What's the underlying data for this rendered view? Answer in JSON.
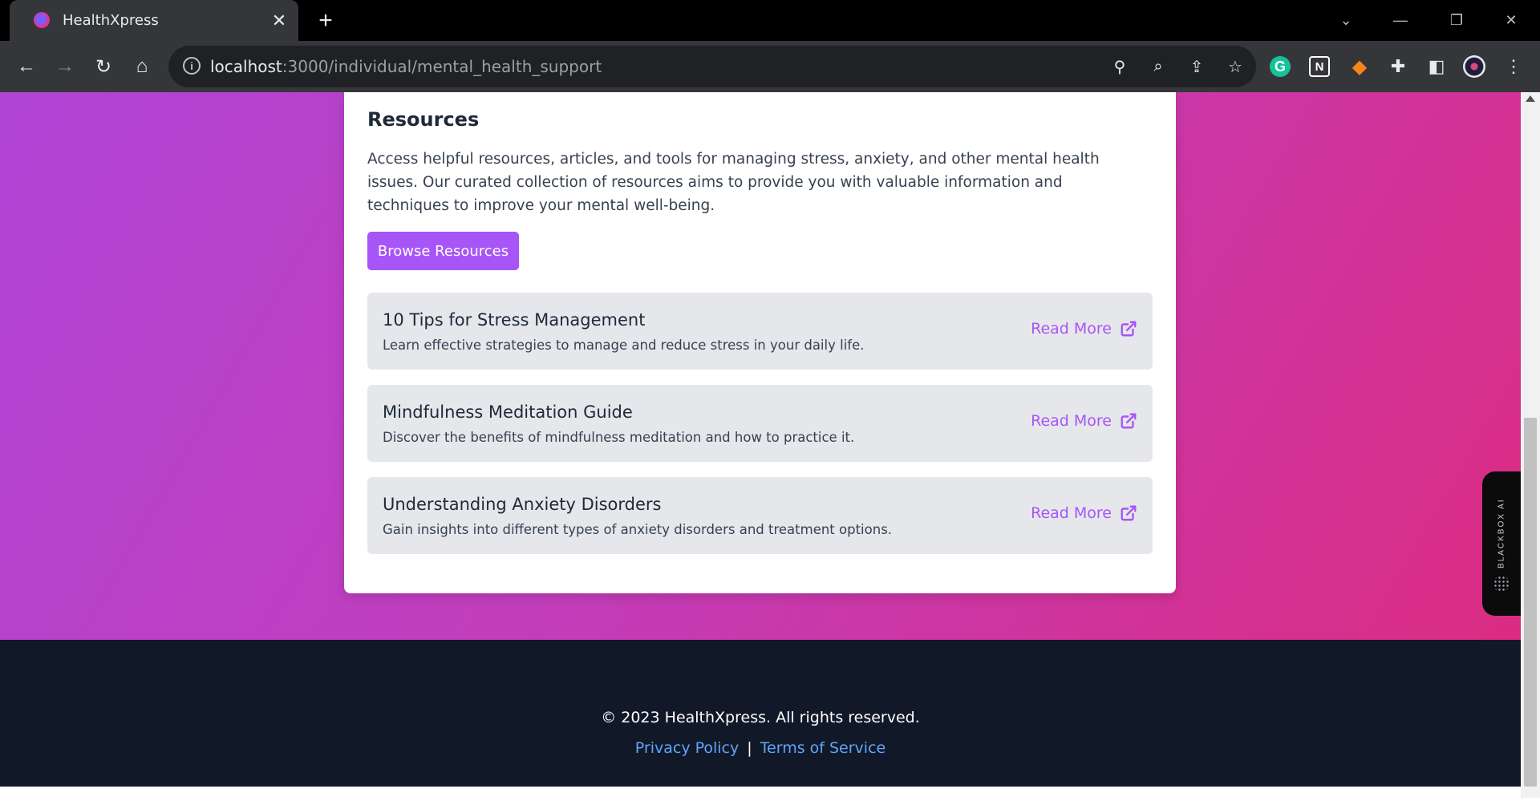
{
  "browser": {
    "tab_title": "HealthXpress",
    "url_host": "localhost",
    "url_path": ":3000/individual/mental_health_support"
  },
  "resources": {
    "title": "Resources",
    "description": "Access helpful resources, articles, and tools for managing stress, anxiety, and other mental health issues. Our curated collection of resources aims to provide you with valuable information and techniques to improve your mental well-being.",
    "browse_label": "Browse Resources",
    "items": [
      {
        "title": "10 Tips for Stress Management",
        "description": "Learn effective strategies to manage and reduce stress in your daily life.",
        "link_label": "Read More"
      },
      {
        "title": "Mindfulness Meditation Guide",
        "description": "Discover the benefits of mindfulness meditation and how to practice it.",
        "link_label": "Read More"
      },
      {
        "title": "Understanding Anxiety Disorders",
        "description": "Gain insights into different types of anxiety disorders and treatment options.",
        "link_label": "Read More"
      }
    ]
  },
  "footer": {
    "copyright": "© 2023 HealthXpress. All rights reserved.",
    "privacy_label": "Privacy Policy",
    "separator": "|",
    "terms_label": "Terms of Service"
  },
  "sidebar_widget": {
    "label": "BLACKBOX AI"
  },
  "colors": {
    "accent": "#a855f7",
    "footer_bg": "#111827",
    "link": "#60a5fa",
    "gradient_start": "#b044d6",
    "gradient_end": "#db2c82"
  },
  "icons": {
    "favicon": "healthxpress-logo-icon",
    "read_more": "external-link-icon"
  }
}
